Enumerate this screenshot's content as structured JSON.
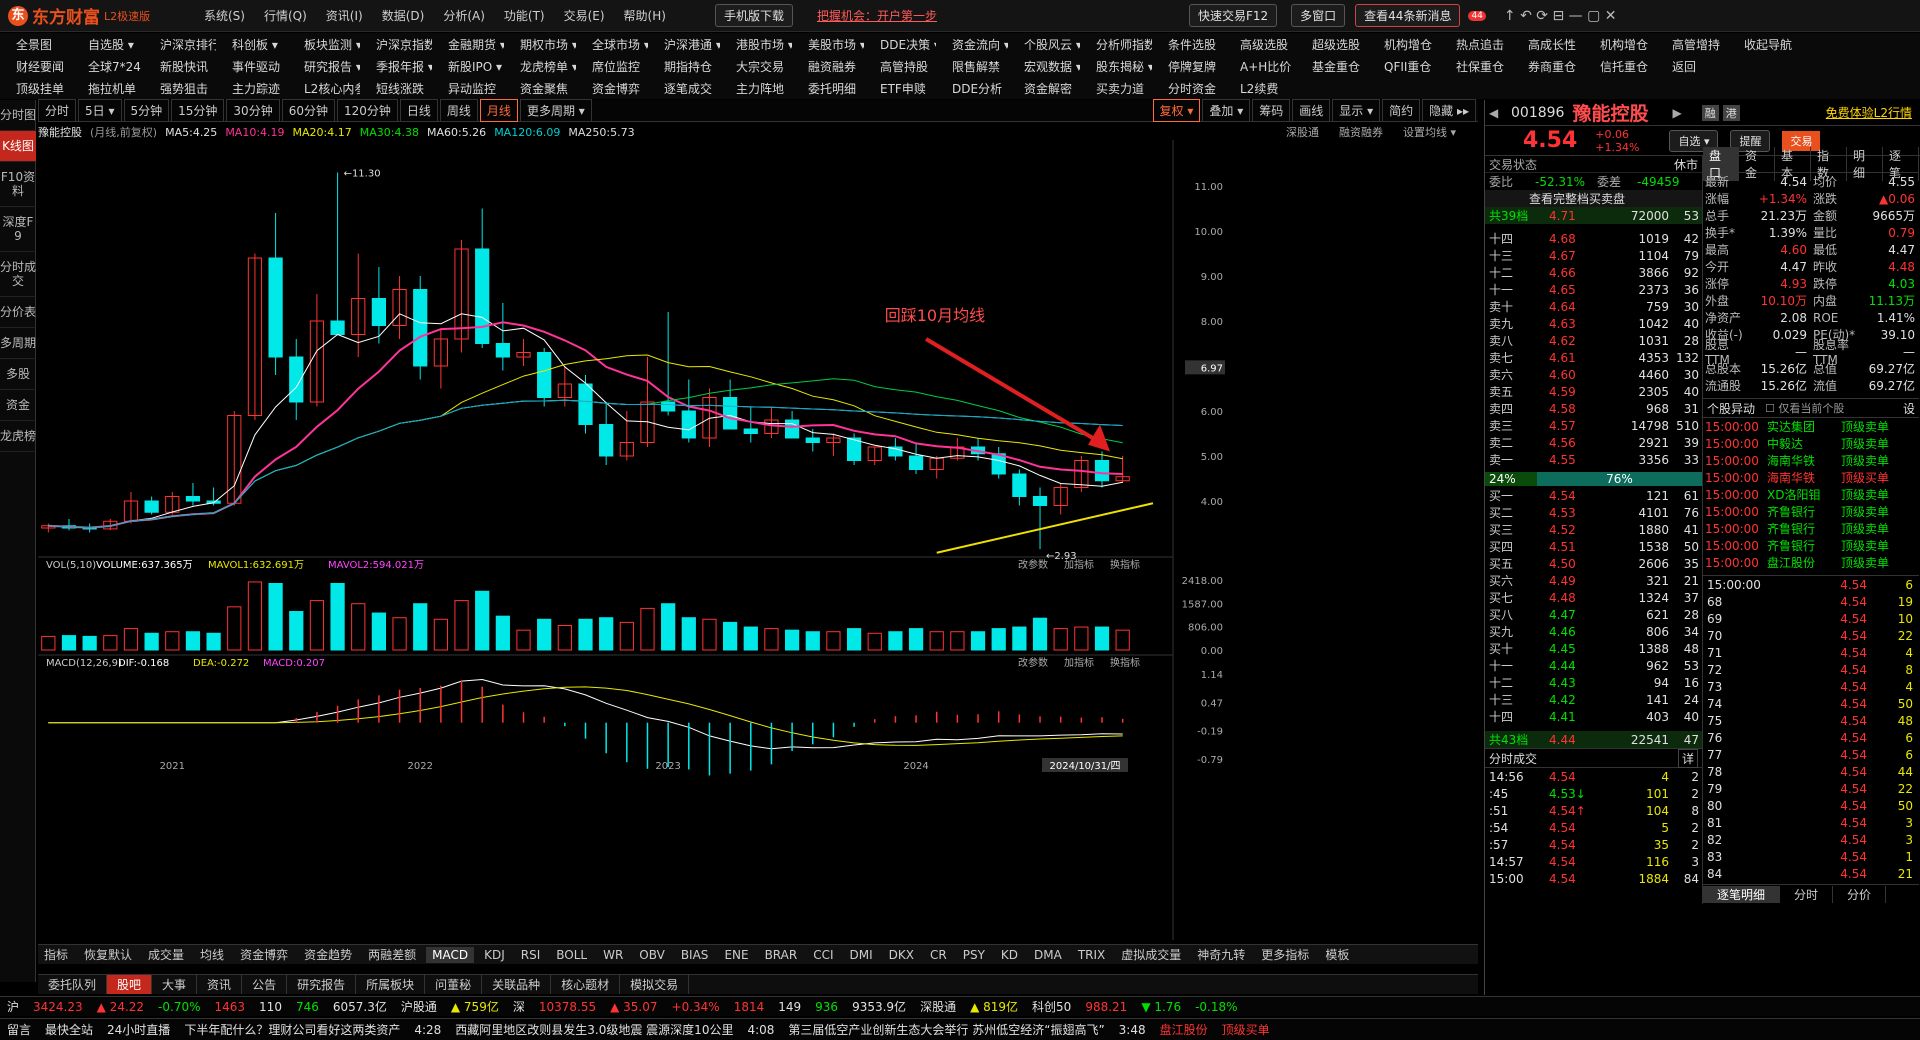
{
  "app": {
    "name": "东方财富",
    "edition": "L2极速版",
    "menus": [
      "系统(S)",
      "行情(Q)",
      "资讯(I)",
      "数据(D)",
      "分析(A)",
      "功能(T)",
      "交易(E)",
      "帮助(H)"
    ],
    "mobile_download": "手机版下载",
    "promo": "把握机会：开户第一步",
    "quick_trade": "快速交易F12",
    "multi_window": "多窗口",
    "messages": "查看44条新消息",
    "msg_badge": "44"
  },
  "nav_rows": [
    [
      "全景图",
      "自选股 ▾",
      "沪深京排行 ▾",
      "科创板 ▾",
      "板块监测 ▾",
      "沪深京指数 ▾",
      "金融期货 ▾",
      "期权市场 ▾",
      "全球市场 ▾",
      "沪深港通 ▾",
      "港股市场 ▾",
      "美股市场 ▾",
      "DDE决策 ▾",
      "资金流向 ▾",
      "个股风云 ▾",
      "分析师指数",
      "条件选股",
      "高级选股",
      "超级选股",
      "机构增仓",
      "热点追击",
      "高成长性",
      "机构增仓",
      "高管增持",
      "收起导航"
    ],
    [
      "财经要闻",
      "全球7*24",
      "新股快讯",
      "事件驱动",
      "研究报告 ▾",
      "季报年报 ▾",
      "新股IPO ▾",
      "龙虎榜单 ▾",
      "席位监控",
      "期指持仓",
      "大宗交易",
      "融资融券",
      "高管持股",
      "限售解禁",
      "宏观数据 ▾",
      "股东揭秘 ▾",
      "停牌复牌",
      "A+H比价",
      "基金重仓",
      "QFII重仓",
      "社保重仓",
      "券商重仓",
      "信托重仓",
      "返回"
    ],
    [
      "顶级挂单",
      "拖拉机单",
      "强势狙击",
      "主力踪迹",
      "L2核心内参",
      "短线涨跌",
      "异动监控",
      "资金聚焦",
      "资金博弈",
      "逐笔成交",
      "主力阵地",
      "委托明细",
      "ETF申赎",
      "DDE分析",
      "资金解密",
      "买卖力道",
      "分时资金",
      "L2续费"
    ]
  ],
  "left_tabs": [
    "分时图",
    "K线图",
    "F10资料",
    "深度F9",
    "分时成交",
    "分价表",
    "多周期",
    "多股",
    "资金",
    "龙虎榜"
  ],
  "periods": [
    "分时",
    "5日 ▾",
    "5分钟",
    "15分钟",
    "30分钟",
    "60分钟",
    "120分钟",
    "日线",
    "周线",
    "月线",
    "更多周期 ▾"
  ],
  "toolbar_right": [
    "复权 ▾",
    "叠加 ▾",
    "筹码",
    "画线",
    "显示 ▾",
    "简约",
    "隐藏 ▸▸"
  ],
  "ma_line": {
    "stock": "豫能控股",
    "mode": "(月线,前复权)",
    "ma5": "MA5:4.25",
    "ma10": "MA10:4.19",
    "ma20": "MA20:4.17",
    "ma30": "MA30:4.38",
    "ma60": "MA60:5.26",
    "ma120": "MA120:6.09",
    "ma250": "MA250:5.73",
    "links": [
      "深股通",
      "融资融券",
      "设置均线 ▾"
    ]
  },
  "annotation": "回踩10月均线",
  "price_labels": {
    "high": "11.30",
    "low": "2.93",
    "current": "6.97"
  },
  "y_ticks": [
    "11.00",
    "10.00",
    "9.00",
    "8.00",
    "7.00",
    "6.00",
    "5.00",
    "4.00"
  ],
  "vol_ticks": [
    "2418.00",
    "1587.00",
    "806.00",
    "0.00"
  ],
  "macd_ticks": [
    "1.14",
    "0.47",
    "-0.19",
    "-0.79"
  ],
  "x_labels": [
    "2021",
    "2022",
    "2023",
    "2024"
  ],
  "date_label": "2024/10/31/四",
  "vol_line": {
    "title": "VOL(5,10)",
    "vol": "VOLUME:637.365万",
    "m1": "MAVOL1:632.691万",
    "m2": "MAVOL2:594.021万",
    "links": [
      "改参数",
      "加指标",
      "换指标"
    ]
  },
  "macd_line": {
    "title": "MACD(12,26,9)",
    "dif": "DIF:-0.168",
    "dea": "DEA:-0.272",
    "macd": "MACD:0.207",
    "links": [
      "改参数",
      "加指标",
      "换指标"
    ]
  },
  "indicators": [
    "指标",
    "恢复默认",
    "成交量",
    "均线",
    "资金博弈",
    "资金趋势",
    "两融差额",
    "MACD",
    "KDJ",
    "RSI",
    "BOLL",
    "WR",
    "OBV",
    "BIAS",
    "ENE",
    "BRAR",
    "CCI",
    "DMI",
    "DKX",
    "CR",
    "PSY",
    "KD",
    "DMA",
    "TRIX",
    "虚拟成交量",
    "神奇九转",
    "更多指标",
    "模板"
  ],
  "bottom_tabs": [
    "委托队列",
    "股吧",
    "大事",
    "资讯",
    "公告",
    "研究报告",
    "所属板块",
    "问董秘",
    "关联品种",
    "核心题材",
    "模拟交易"
  ],
  "chart_data": {
    "type": "candlestick",
    "title": "豫能控股 月线 前复权",
    "x": [
      "2020-07",
      "2020-08",
      "2020-09",
      "2020-10",
      "2020-11",
      "2020-12",
      "2021-01",
      "2021-02",
      "2021-03",
      "2021-04",
      "2021-05",
      "2021-06",
      "2021-07",
      "2021-08",
      "2021-09",
      "2021-10",
      "2021-11",
      "2021-12",
      "2022-01",
      "2022-02",
      "2022-03",
      "2022-04",
      "2022-05",
      "2022-06",
      "2022-07",
      "2022-08",
      "2022-09",
      "2022-10",
      "2022-11",
      "2022-12",
      "2023-01",
      "2023-02",
      "2023-03",
      "2023-04",
      "2023-05",
      "2023-06",
      "2023-07",
      "2023-08",
      "2023-09",
      "2023-10",
      "2023-11",
      "2023-12",
      "2024-01",
      "2024-02",
      "2024-03",
      "2024-04",
      "2024-05",
      "2024-06",
      "2024-07",
      "2024-08",
      "2024-09",
      "2024-10",
      "2024-11"
    ],
    "ohlc": [
      [
        3.4,
        3.5,
        3.3,
        3.45
      ],
      [
        3.45,
        3.6,
        3.35,
        3.4
      ],
      [
        3.4,
        3.5,
        3.3,
        3.38
      ],
      [
        3.38,
        3.6,
        3.35,
        3.55
      ],
      [
        3.55,
        4.2,
        3.5,
        4.0
      ],
      [
        4.0,
        4.1,
        3.7,
        3.75
      ],
      [
        3.75,
        4.2,
        3.7,
        4.1
      ],
      [
        4.1,
        4.4,
        3.9,
        4.0
      ],
      [
        4.0,
        4.3,
        3.9,
        3.95
      ],
      [
        3.95,
        6.0,
        3.9,
        5.9
      ],
      [
        5.9,
        9.5,
        5.8,
        9.4
      ],
      [
        9.4,
        10.4,
        6.8,
        7.2
      ],
      [
        7.2,
        7.6,
        5.8,
        6.2
      ],
      [
        6.2,
        8.6,
        6.1,
        8.0
      ],
      [
        8.0,
        11.3,
        7.7,
        7.7
      ],
      [
        7.7,
        9.5,
        7.2,
        8.5
      ],
      [
        8.5,
        9.2,
        7.5,
        7.9
      ],
      [
        7.9,
        9.0,
        7.6,
        8.7
      ],
      [
        8.7,
        9.0,
        6.7,
        7.0
      ],
      [
        7.0,
        7.8,
        6.5,
        7.6
      ],
      [
        7.6,
        9.8,
        7.3,
        9.6
      ],
      [
        9.6,
        10.5,
        7.4,
        7.5
      ],
      [
        7.5,
        8.4,
        6.9,
        7.2
      ],
      [
        7.2,
        7.6,
        7.0,
        7.3
      ],
      [
        7.3,
        7.4,
        6.1,
        6.3
      ],
      [
        6.3,
        7.0,
        6.1,
        6.6
      ],
      [
        6.6,
        6.8,
        5.5,
        5.7
      ],
      [
        5.7,
        6.2,
        4.8,
        5.0
      ],
      [
        5.0,
        6.0,
        4.9,
        5.3
      ],
      [
        5.3,
        7.2,
        5.2,
        6.2
      ],
      [
        6.2,
        8.2,
        5.9,
        6.0
      ],
      [
        6.0,
        6.7,
        5.3,
        5.4
      ],
      [
        5.4,
        6.5,
        5.2,
        6.3
      ],
      [
        6.3,
        6.7,
        5.6,
        5.6
      ],
      [
        5.6,
        6.1,
        5.3,
        5.5
      ],
      [
        5.5,
        6.1,
        5.4,
        5.8
      ],
      [
        5.8,
        6.0,
        5.4,
        5.4
      ],
      [
        5.4,
        5.6,
        5.1,
        5.3
      ],
      [
        5.3,
        5.5,
        5.0,
        5.4
      ],
      [
        5.4,
        5.5,
        4.8,
        4.9
      ],
      [
        4.9,
        5.2,
        4.8,
        5.2
      ],
      [
        5.2,
        5.4,
        4.9,
        5.0
      ],
      [
        5.0,
        5.3,
        4.6,
        4.7
      ],
      [
        4.7,
        5.0,
        4.5,
        4.95
      ],
      [
        4.95,
        5.4,
        4.9,
        5.2
      ],
      [
        5.2,
        5.4,
        4.9,
        5.05
      ],
      [
        5.05,
        5.2,
        4.5,
        4.6
      ],
      [
        4.6,
        4.7,
        3.9,
        4.1
      ],
      [
        4.1,
        4.3,
        2.93,
        3.9
      ],
      [
        3.9,
        4.4,
        3.7,
        4.3
      ],
      [
        4.3,
        5.0,
        4.2,
        4.9
      ],
      [
        4.9,
        5.1,
        4.3,
        4.45
      ],
      [
        4.45,
        5.0,
        4.4,
        4.54
      ]
    ],
    "ylim": [
      2.8,
      11.8
    ]
  },
  "quote": {
    "code": "001896",
    "name": "豫能控股",
    "price": "4.54",
    "chg": "+0.06",
    "pct": "+1.34%",
    "badges": [
      "融",
      "港"
    ],
    "promo": "免费体验L2行情",
    "buttons": [
      "自选 ▾",
      "提醒",
      "交易"
    ],
    "status": "交易状态",
    "status_val": "休市",
    "wb_label": "委比",
    "wb": "-52.31%",
    "wc_label": "委差",
    "wc": "-49459",
    "full_queue": "查看完整档买卖盘"
  },
  "sell_total": {
    "label": "共39档",
    "price": "4.71",
    "vol": "72000",
    "n": "53"
  },
  "sells": [
    [
      "十四",
      "4.68",
      "1019",
      "42"
    ],
    [
      "十三",
      "4.67",
      "1104",
      "79"
    ],
    [
      "十二",
      "4.66",
      "3866",
      "92"
    ],
    [
      "十一",
      "4.65",
      "2373",
      "36"
    ],
    [
      "卖十",
      "4.64",
      "759",
      "30"
    ],
    [
      "卖九",
      "4.63",
      "1042",
      "40"
    ],
    [
      "卖八",
      "4.62",
      "1031",
      "28"
    ],
    [
      "卖七",
      "4.61",
      "4353",
      "132"
    ],
    [
      "卖六",
      "4.60",
      "4460",
      "30"
    ],
    [
      "卖五",
      "4.59",
      "2305",
      "40"
    ],
    [
      "卖四",
      "4.58",
      "968",
      "31"
    ],
    [
      "卖三",
      "4.57",
      "14798",
      "510"
    ],
    [
      "卖二",
      "4.56",
      "2921",
      "39"
    ],
    [
      "卖一",
      "4.55",
      "3356",
      "33"
    ]
  ],
  "ratio": {
    "buy": "24%",
    "sell": "76%"
  },
  "buys": [
    [
      "买一",
      "4.54",
      "121",
      "61"
    ],
    [
      "买二",
      "4.53",
      "4101",
      "76"
    ],
    [
      "买三",
      "4.52",
      "1880",
      "41"
    ],
    [
      "买四",
      "4.51",
      "1538",
      "50"
    ],
    [
      "买五",
      "4.50",
      "2606",
      "35"
    ],
    [
      "买六",
      "4.49",
      "321",
      "21"
    ],
    [
      "买七",
      "4.48",
      "1324",
      "37"
    ],
    [
      "买八",
      "4.47",
      "621",
      "28"
    ],
    [
      "买九",
      "4.46",
      "806",
      "34"
    ],
    [
      "买十",
      "4.45",
      "1388",
      "48"
    ],
    [
      "十一",
      "4.44",
      "962",
      "53"
    ],
    [
      "十二",
      "4.43",
      "94",
      "16"
    ],
    [
      "十三",
      "4.42",
      "141",
      "24"
    ],
    [
      "十四",
      "4.41",
      "403",
      "40"
    ]
  ],
  "buy_total": {
    "label": "共43档",
    "price": "4.44",
    "vol": "22541",
    "n": "47"
  },
  "fs_title": "分时成交",
  "fs_btn": "详",
  "fs_trades": [
    [
      "14:56",
      "4.54",
      "4",
      "2"
    ],
    [
      ":45",
      "4.53↓",
      "101",
      "2"
    ],
    [
      ":51",
      "4.54↑",
      "104",
      "8"
    ],
    [
      ":54",
      "4.54",
      "5",
      "2"
    ],
    [
      ":57",
      "4.54",
      "35",
      "2"
    ],
    [
      "14:57",
      "4.54",
      "116",
      "3"
    ],
    [
      "15:00",
      "4.54",
      "1884",
      "84"
    ]
  ],
  "info_tabs": [
    "盘口",
    "资金",
    "基本",
    "指数",
    "明细",
    "逐笔"
  ],
  "stats": [
    [
      "最新",
      "4.54",
      "均价",
      "4.55"
    ],
    [
      "涨幅",
      "+1.34%",
      "涨跌",
      "▲0.06"
    ],
    [
      "总手",
      "21.23万",
      "金额",
      "9665万"
    ],
    [
      "换手*",
      "1.39%",
      "量比",
      "0.79"
    ],
    [
      "最高",
      "4.60",
      "最低",
      "4.47"
    ],
    [
      "今开",
      "4.47",
      "昨收",
      "4.48"
    ],
    [
      "涨停",
      "4.93",
      "跌停",
      "4.03"
    ],
    [
      "外盘",
      "10.10万",
      "内盘",
      "11.13万"
    ],
    [
      "净资产",
      "2.08",
      "ROE",
      "1.41%"
    ],
    [
      "收益(-)",
      "0.029",
      "PE(动)*",
      "39.10"
    ],
    [
      "股息TTM",
      "—",
      "股息率TTM",
      "—"
    ],
    [
      "总股本",
      "15.26亿",
      "总值",
      "69.27亿"
    ],
    [
      "流通股",
      "15.26亿",
      "流值",
      "69.27亿"
    ]
  ],
  "yd_title": "个股异动",
  "yd_check": "仅看当前个股",
  "yd_btn": "设",
  "yd": [
    [
      "15:00:00",
      "实达集团",
      "顶级卖单"
    ],
    [
      "15:00:00",
      "中毅达",
      "顶级卖单"
    ],
    [
      "15:00:00",
      "海南华铁",
      "顶级卖单"
    ],
    [
      "15:00:00",
      "海南华铁",
      "顶级买单"
    ],
    [
      "15:00:00",
      "XD洛阳钼",
      "顶级卖单"
    ],
    [
      "15:00:00",
      "齐鲁银行",
      "顶级卖单"
    ],
    [
      "15:00:00",
      "齐鲁银行",
      "顶级卖单"
    ],
    [
      "15:00:00",
      "齐鲁银行",
      "顶级卖单"
    ],
    [
      "15:00:00",
      "盘江股份",
      "顶级卖单"
    ]
  ],
  "zb": [
    [
      "15:00:00",
      "4.54",
      "6"
    ],
    [
      "68",
      "4.54",
      "19"
    ],
    [
      "69",
      "4.54",
      "10"
    ],
    [
      "70",
      "4.54",
      "22"
    ],
    [
      "71",
      "4.54",
      "4"
    ],
    [
      "72",
      "4.54",
      "8"
    ],
    [
      "73",
      "4.54",
      "4"
    ],
    [
      "74",
      "4.54",
      "50"
    ],
    [
      "75",
      "4.54",
      "48"
    ],
    [
      "76",
      "4.54",
      "6"
    ],
    [
      "77",
      "4.54",
      "6"
    ],
    [
      "78",
      "4.54",
      "44"
    ],
    [
      "79",
      "4.54",
      "22"
    ],
    [
      "80",
      "4.54",
      "50"
    ],
    [
      "81",
      "4.54",
      "3"
    ],
    [
      "82",
      "4.54",
      "3"
    ],
    [
      "83",
      "4.54",
      "1"
    ],
    [
      "84",
      "4.54",
      "21"
    ]
  ],
  "zb_tabs": [
    "逐笔明细",
    "分时",
    "分价"
  ],
  "status1": [
    [
      "沪",
      "wh"
    ],
    [
      "3424.23",
      "red"
    ],
    [
      "▲ 24.22",
      "red"
    ],
    [
      "-0.70%",
      "green"
    ],
    [
      "1463",
      "red"
    ],
    [
      "110",
      "wh"
    ],
    [
      "746",
      "green"
    ],
    [
      "6057.3亿",
      "wh"
    ],
    [
      "沪股通",
      "wh"
    ],
    [
      "▲ 759亿",
      "yel"
    ],
    [
      "深",
      "wh"
    ],
    [
      "10378.55",
      "red"
    ],
    [
      "▲ 35.07",
      "red"
    ],
    [
      "+0.34%",
      "red"
    ],
    [
      "1814",
      "red"
    ],
    [
      "149",
      "wh"
    ],
    [
      "936",
      "green"
    ],
    [
      "9353.9亿",
      "wh"
    ],
    [
      "深股通",
      "wh"
    ],
    [
      "▲ 819亿",
      "yel"
    ],
    [
      "科创50",
      "wh"
    ],
    [
      "988.21",
      "red"
    ],
    [
      "▼ 1.76",
      "green"
    ],
    [
      "-0.18%",
      "green"
    ]
  ],
  "status2": [
    [
      "留言",
      "wh"
    ],
    [
      "最快全站",
      "wh"
    ],
    [
      "24小时直播",
      "wh"
    ],
    [
      "下半年配什么？理财公司看好这两类资产",
      "wh"
    ],
    [
      "4:28",
      "wh"
    ],
    [
      "西藏阿里地区改则县发生3.0级地震 震源深度10公里",
      "wh"
    ],
    [
      "4:08",
      "wh"
    ],
    [
      "第三届低空产业创新生态大会举行 苏州低空经济“振翅高飞”",
      "wh"
    ],
    [
      "3:48",
      "wh"
    ],
    [
      "盘江股份",
      "red"
    ],
    [
      "顶级买单",
      "red"
    ]
  ]
}
